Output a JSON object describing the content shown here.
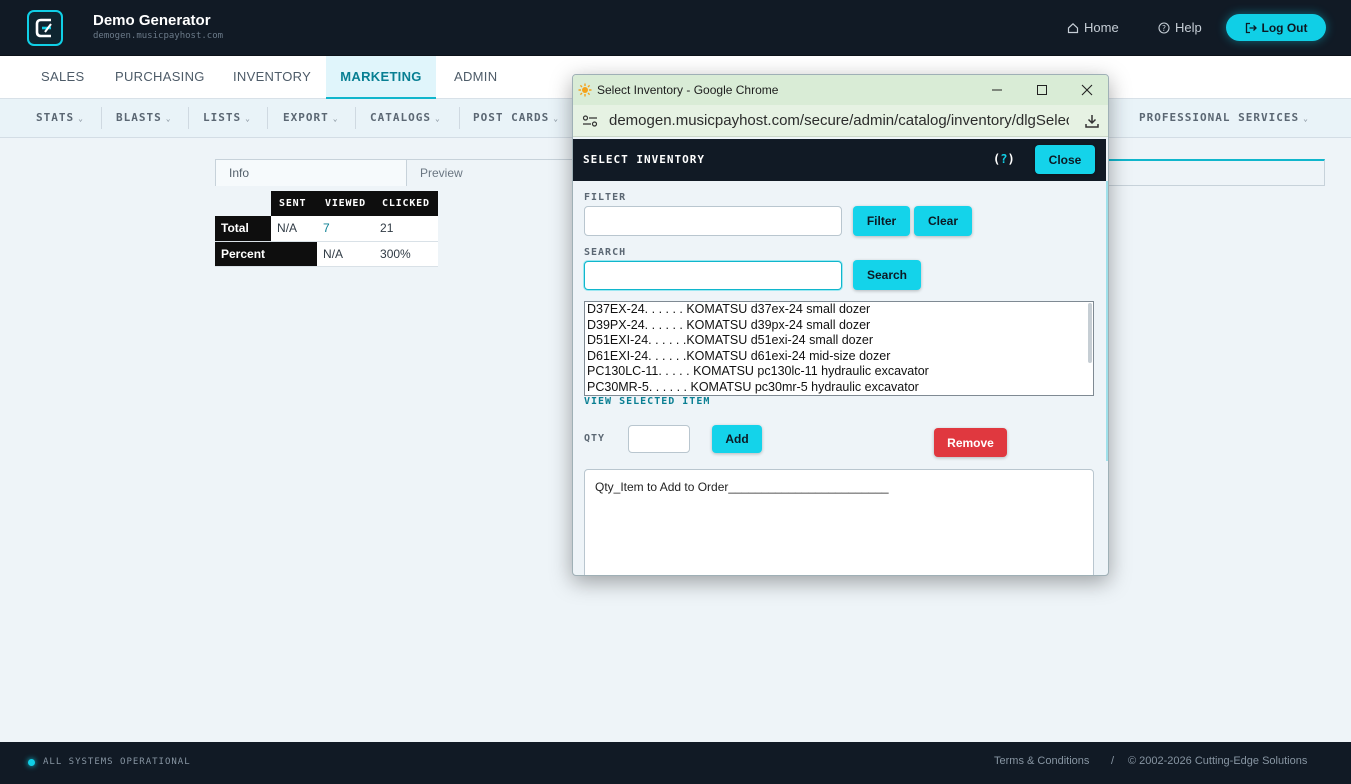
{
  "header": {
    "brand_title": "Demo Generator",
    "brand_sub": "demogen.musicpayhost.com",
    "home": "Home",
    "help": "Help",
    "logout": "Log Out"
  },
  "main_nav": {
    "tabs": [
      "SALES",
      "PURCHASING",
      "INVENTORY",
      "MARKETING",
      "ADMIN"
    ],
    "active": "MARKETING"
  },
  "sub_nav": {
    "items": [
      "STATS",
      "BLASTS",
      "LISTS",
      "EXPORT",
      "CATALOGS",
      "POST CARDS",
      "PROFESSIONAL SERVICES"
    ]
  },
  "content": {
    "tab_info": "Info",
    "tab_preview": "Preview",
    "stats_table": {
      "headers": [
        "SENT",
        "VIEWED",
        "CLICKED"
      ],
      "rows": [
        {
          "label": "Total",
          "sent": "N/A",
          "viewed": "7",
          "clicked": "21"
        },
        {
          "label": "Percent",
          "viewed": "N/A",
          "clicked": "300%"
        }
      ]
    }
  },
  "popup": {
    "window_title": "Select Inventory - Google Chrome",
    "url": "demogen.musicpayhost.com/secure/admin/catalog/inventory/dlgSelectIn...",
    "dialog_title": "SELECT INVENTORY",
    "help_open": "(",
    "help_q": "?",
    "help_close": ")",
    "close": "Close",
    "filter_label": "FILTER",
    "filter_btn": "Filter",
    "clear_btn": "Clear",
    "search_label": "SEARCH",
    "search_btn": "Search",
    "items": [
      "D37EX-24. . . . . . KOMATSU d37ex-24 small dozer",
      "D39PX-24. . . . . . KOMATSU d39px-24 small dozer",
      "D51EXI-24. . . . . .KOMATSU d51exi-24 small dozer",
      "D61EXI-24. . . . . .KOMATSU d61exi-24 mid-size dozer",
      "PC130LC-11. . . . . KOMATSU pc130lc-11 hydraulic excavator",
      "PC30MR-5. . . . . . KOMATSU pc30mr-5 hydraulic excavator"
    ],
    "view_selected": "VIEW SELECTED ITEM",
    "qty_label": "QTY",
    "add_btn": "Add",
    "remove_btn": "Remove",
    "order_text": "Qty_Item to Add to Order________________________"
  },
  "footer": {
    "status": "ALL SYSTEMS OPERATIONAL",
    "terms": "Terms & Conditions",
    "sep": "/",
    "copyright": "© 2002-2026 Cutting-Edge Solutions"
  }
}
